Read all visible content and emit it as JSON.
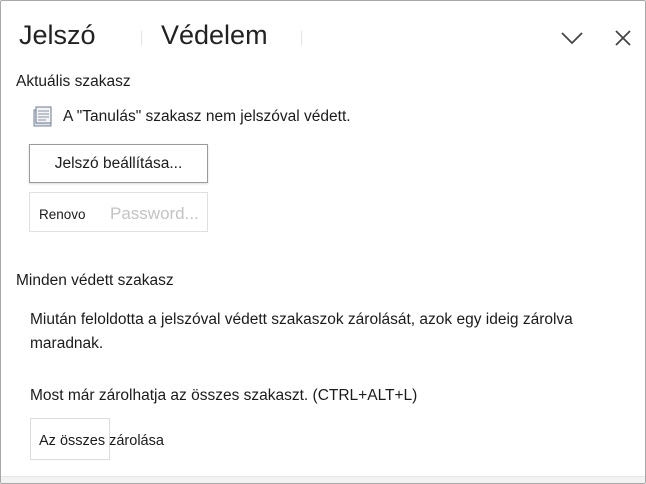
{
  "header": {
    "title_part1": "Jelszó",
    "title_part2": "Védelem",
    "collapse_icon": "chevron-down-icon",
    "close_icon": "close-icon"
  },
  "current_section": {
    "heading": "Aktuális szakasz",
    "status_icon": "section-page-icon",
    "status_text": "A \"Tanulás\" szakasz nem jelszóval védett.",
    "set_password_label": "Jelszó beállítása...",
    "change_password_label_part1": "Renovo",
    "change_password_label_part2": "Password..."
  },
  "all_protected": {
    "heading": "Minden védett szakasz",
    "description": "Miután feloldotta a jelszóval védett szakaszok zárolását, azok egy ideig zárolva maradnak.",
    "lock_hint": "Most már zárolhatja az összes szakaszt. (CTRL+ALT+L)",
    "lock_all_label": "Az összes zárolása"
  },
  "colors": {
    "border": "#a8a8a8",
    "button_border": "#9a9a9a",
    "disabled_text": "#c3c3c3",
    "text": "#1b1b1b"
  }
}
